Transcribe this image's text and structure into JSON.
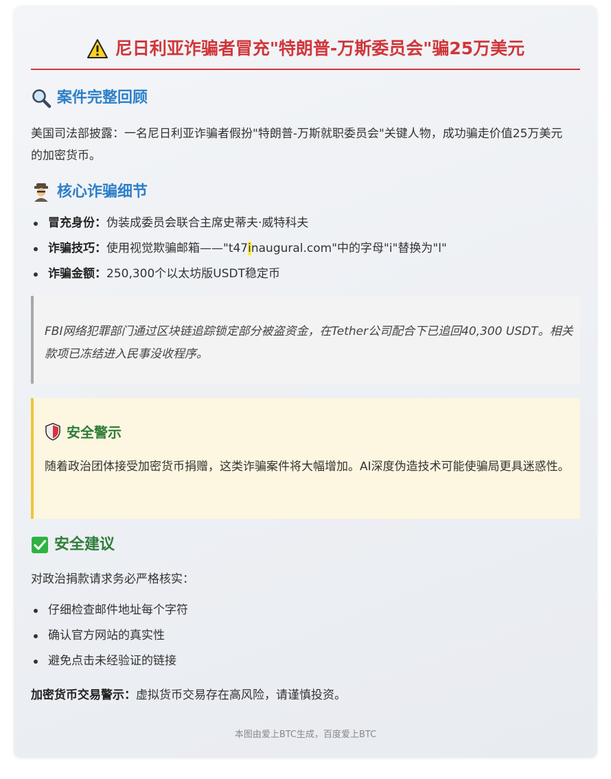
{
  "header": {
    "title": "尼日利亚诈骗者冒充\"特朗普-万斯委员会\"骗25万美元",
    "icon": "warning-icon"
  },
  "review": {
    "heading": "案件完整回顾",
    "icon": "magnifier-icon",
    "text": "美国司法部披露：一名尼日利亚诈骗者假扮\"特朗普-万斯就职委员会\"关键人物，成功骗走价值25万美元的加密货币。"
  },
  "details": {
    "heading": "核心诈骗细节",
    "icon": "detective-icon",
    "items": [
      {
        "label": "冒充身份：",
        "text": "伪装成委员会联合主席史蒂夫·威特科夫"
      },
      {
        "label": "诈骗技巧：",
        "text_before": "使用视觉欺骗邮箱——\"t47",
        "highlight": "i",
        "text_after": "naugural.com\"中的字母\"i\"替换为\"l\""
      },
      {
        "label": "诈骗金额：",
        "text": "250,300个以太坊版USDT稳定币"
      }
    ]
  },
  "quote": {
    "text": "FBI网络犯罪部门通过区块链追踪锁定部分被盗资金，在Tether公司配合下已追回40,300 USDT。相关款项已冻结进入民事没收程序。"
  },
  "alert": {
    "heading": "安全警示",
    "icon": "shield-icon",
    "text": "随着政治团体接受加密货币捐赠，这类诈骗案件将大幅增加。AI深度伪造技术可能使骗局更具迷惑性。"
  },
  "advice": {
    "heading": "安全建议",
    "icon": "check-icon",
    "intro": "对政治捐款请求务必严格核实：",
    "items": [
      "仔细检查邮件地址每个字符",
      "确认官方网站的真实性",
      "避免点击未经验证的链接"
    ]
  },
  "risk": {
    "label": "加密货币交易警示：",
    "text": "虚拟货币交易存在高风险，请谨慎投资。"
  },
  "footer": {
    "text": "本图由爱上BTC生成，百度爱上BTC"
  },
  "colors": {
    "title_red": "#d0363a",
    "heading_blue": "#2d7fc9",
    "heading_green": "#2f7d3a",
    "highlight_yellow": "#ffeb3b",
    "alert_border": "#f0c53a"
  }
}
